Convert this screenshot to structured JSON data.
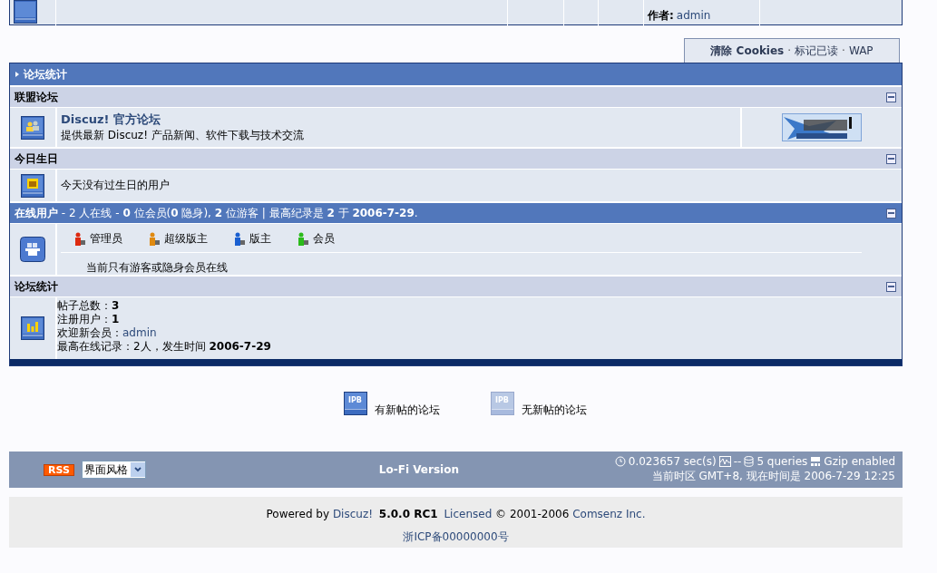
{
  "forum_row": {
    "author_label": "作者:",
    "author": "admin"
  },
  "nav_links": [
    {
      "text": "清除 Cookies",
      "bold": true
    },
    {
      "text": "标记已读",
      "bold": false
    },
    {
      "text": "WAP",
      "bold": false
    }
  ],
  "nav_separator": "·",
  "stats_panel": {
    "title": "论坛统计",
    "sections": [
      {
        "kind": "links",
        "title": "联盟论坛",
        "forum": {
          "name": "Discuz! 官方论坛",
          "description": "提供最新 Discuz! 产品新闻、软件下载与技术交流"
        }
      },
      {
        "kind": "birthdays",
        "title": "今日生日",
        "message": "今天没有过生日的用户"
      },
      {
        "kind": "online",
        "title": "**在线用户** -  2 人在线 - **0** 位会员(**0** 隐身), **2** 位游客 | 最高纪录是 **2** 于 **2006-7-29**.",
        "groups": [
          {
            "label": "管理员",
            "color": "#dd2a10"
          },
          {
            "label": "超级版主",
            "color": "#e08a10"
          },
          {
            "label": "版主",
            "color": "#1a5fd0"
          },
          {
            "label": "会员",
            "color": "#2bbb1a"
          }
        ],
        "message": "当前只有游客或隐身会员在线"
      },
      {
        "kind": "stats",
        "title": "论坛统计",
        "lines": [
          {
            "text": "帖子总数：**3**"
          },
          {
            "text": "注册用户：**1**"
          },
          {
            "text": "欢迎新会员：",
            "link": "admin"
          },
          {
            "text": "最高在线记录：2人，发生时间 **2006-7-29**"
          }
        ]
      }
    ]
  },
  "legend": [
    {
      "kind": "new",
      "icon_text": "IPB",
      "label": "有新帖的论坛"
    },
    {
      "kind": "old",
      "icon_text": "IPB",
      "label": "无新帖的论坛"
    }
  ],
  "footer": {
    "rss": "RSS",
    "style_select": "界面风格",
    "lofi": "Lo-Fi Version",
    "time": "0.023657 sec(s)",
    "load": "--",
    "queries": "5 queries",
    "gzip": "Gzip enabled",
    "timezone": "当前时区 GMT+8, 现在时间是 2006-7-29 12:25"
  },
  "copyright": {
    "parts": [
      {
        "kind": "plain",
        "text": "Powered by"
      },
      {
        "kind": "link",
        "text": "Discuz!"
      },
      {
        "kind": "bold",
        "text": "5.0.0 RC1"
      },
      {
        "kind": "link",
        "text": "Licensed"
      },
      {
        "kind": "plain",
        "text": "© 2001-2006"
      },
      {
        "kind": "link",
        "text": "Comsenz Inc."
      }
    ],
    "icp": "浙ICP备00000000号"
  }
}
